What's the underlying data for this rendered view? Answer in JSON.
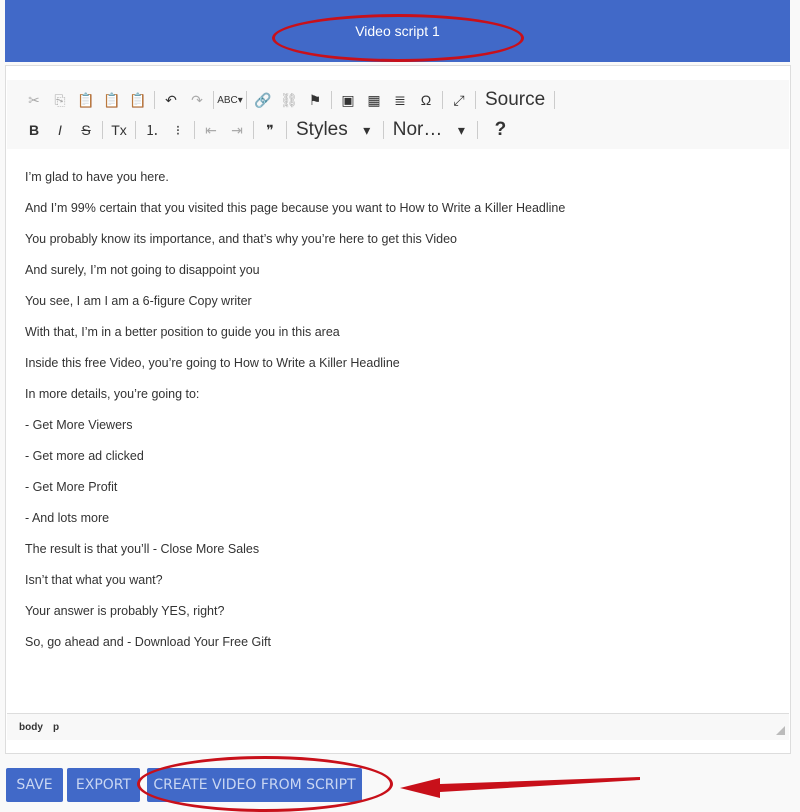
{
  "header": {
    "title": "Video script 1"
  },
  "toolbar": {
    "row1": [
      {
        "icon": "cut-icon",
        "glyph": "✂",
        "disabled": true
      },
      {
        "icon": "copy-icon",
        "glyph": "⎘",
        "disabled": true
      },
      {
        "icon": "paste-icon",
        "glyph": "📋"
      },
      {
        "icon": "paste-text-icon",
        "glyph": "📋"
      },
      {
        "icon": "paste-word-icon",
        "glyph": "📋"
      },
      {
        "sep": true
      },
      {
        "icon": "undo-icon",
        "glyph": "↶"
      },
      {
        "icon": "redo-icon",
        "glyph": "↷",
        "disabled": true
      },
      {
        "sep": true
      },
      {
        "icon": "spellcheck-icon",
        "glyph": "ABC▾"
      },
      {
        "sep": true
      },
      {
        "icon": "link-icon",
        "glyph": "🔗"
      },
      {
        "icon": "unlink-icon",
        "glyph": "⛓",
        "disabled": true
      },
      {
        "icon": "anchor-flag-icon",
        "glyph": "⚑"
      },
      {
        "sep": true
      },
      {
        "icon": "image-icon",
        "glyph": "▣"
      },
      {
        "icon": "table-icon",
        "glyph": "▦"
      },
      {
        "icon": "horizontal-line-icon",
        "glyph": "≣"
      },
      {
        "icon": "special-char-icon",
        "glyph": "Ω"
      },
      {
        "sep": true
      },
      {
        "icon": "maximize-icon",
        "glyph": "⤢"
      },
      {
        "sep": true
      }
    ],
    "source_label": "Source",
    "row2": [
      {
        "icon": "bold-icon",
        "glyph": "B"
      },
      {
        "icon": "italic-icon",
        "glyph": "I"
      },
      {
        "icon": "strike-icon",
        "glyph": "S"
      },
      {
        "sep": true
      },
      {
        "icon": "remove-format-icon",
        "glyph": "Tx"
      },
      {
        "sep": true
      },
      {
        "icon": "numbered-list-icon",
        "glyph": "⒈"
      },
      {
        "icon": "bulleted-list-icon",
        "glyph": "⁝"
      },
      {
        "sep": true
      },
      {
        "icon": "outdent-icon",
        "glyph": "⇤",
        "disabled": true
      },
      {
        "icon": "indent-icon",
        "glyph": "⇥",
        "disabled": true
      },
      {
        "sep": true
      },
      {
        "icon": "blockquote-icon",
        "glyph": "❞"
      },
      {
        "sep": true
      }
    ],
    "styles_label": "Styles",
    "format_label": "Nor…",
    "help_label": "?"
  },
  "content": [
    "I’m glad to have you here.",
    "And I’m 99% certain that you visited this page because you want to How to Write a Killer Headline",
    "You probably know its importance, and that’s why you’re here to get this Video",
    "And surely, I’m not going to disappoint you",
    "You see, I am I am a 6-figure Copy writer",
    "With that, I’m in a better position to guide you in this area",
    "Inside this free Video, you’re going to How to Write a Killer Headline",
    "In more details, you’re going to:",
    "- Get More Viewers",
    "- Get more ad clicked",
    "- Get More Profit",
    "- And lots more",
    "The result is that you’ll - Close More Sales",
    "Isn’t that what you want?",
    "Your answer is probably YES, right?",
    "So, go ahead and - Download Your Free Gift"
  ],
  "path": {
    "body": "body",
    "p": "p"
  },
  "buttons": {
    "save": "SAVE",
    "export": "EXPORT",
    "create": "CREATE VIDEO FROM SCRIPT"
  },
  "colors": {
    "accent": "#4169c8",
    "annotation": "#c8101a"
  }
}
